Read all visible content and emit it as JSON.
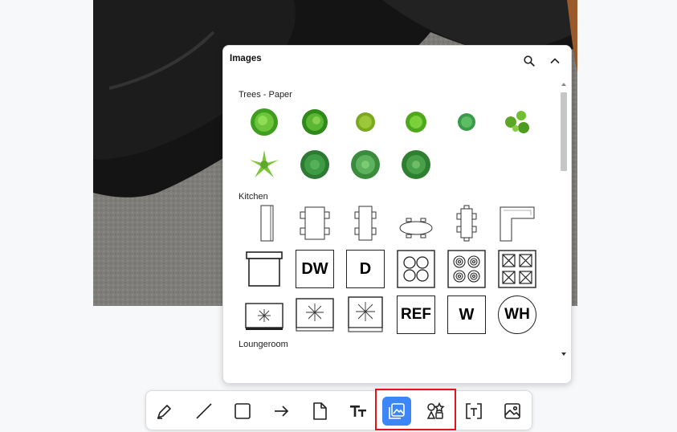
{
  "panel": {
    "title": "Images",
    "search_icon": "search-icon",
    "collapse_icon": "chevron-up-icon"
  },
  "sections": [
    {
      "title": "Trees - Paper"
    },
    {
      "title": "Kitchen"
    },
    {
      "title": "Loungeroom"
    }
  ],
  "kitchen_labels": {
    "dishwasher": "DW",
    "dryer": "D",
    "refrigerator": "REF",
    "washer": "W",
    "water_heater": "WH"
  },
  "toolbar": {
    "tools": [
      "pen-icon",
      "line-icon",
      "rectangle-icon",
      "arrow-icon",
      "note-icon",
      "text-icon",
      "images-icon",
      "shapes-icon",
      "frame-icon",
      "image-upload-icon"
    ],
    "active_tool": "images-icon",
    "highlighted_tools": [
      "images-icon",
      "shapes-icon"
    ]
  },
  "colors": {
    "accent": "#3d86f7",
    "highlight": "#e3141c",
    "tree_green": "#4caf2a"
  }
}
